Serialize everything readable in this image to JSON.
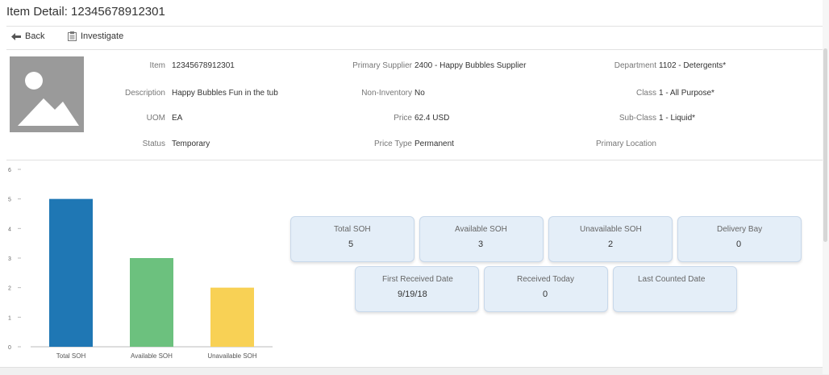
{
  "page": {
    "title": "Item Detail: 12345678912301"
  },
  "toolbar": {
    "back_label": "Back",
    "investigate_label": "Investigate"
  },
  "details": {
    "item_label": "Item",
    "item_value": "12345678912301",
    "description_label": "Description",
    "description_value": "Happy Bubbles Fun in the tub",
    "uom_label": "UOM",
    "uom_value": "EA",
    "status_label": "Status",
    "status_value": "Temporary",
    "primary_supplier_label": "Primary Supplier",
    "primary_supplier_value": "2400 - Happy Bubbles Supplier",
    "non_inventory_label": "Non-Inventory",
    "non_inventory_value": "No",
    "price_label": "Price",
    "price_value": "62.4 USD",
    "price_type_label": "Price Type",
    "price_type_value": "Permanent",
    "department_label": "Department",
    "department_value": "1102 - Detergents*",
    "class_label": "Class",
    "class_value": "1 - All Purpose*",
    "subclass_label": "Sub-Class",
    "subclass_value": "1 - Liquid*",
    "primary_location_label": "Primary Location",
    "primary_location_value": ""
  },
  "tiles": {
    "total_soh_label": "Total SOH",
    "total_soh_value": "5",
    "available_soh_label": "Available SOH",
    "available_soh_value": "3",
    "unavailable_soh_label": "Unavailable SOH",
    "unavailable_soh_value": "2",
    "delivery_bay_label": "Delivery Bay",
    "delivery_bay_value": "0",
    "first_received_label": "First Received Date",
    "first_received_value": "9/19/18",
    "received_today_label": "Received Today",
    "received_today_value": "0",
    "last_counted_label": "Last Counted Date",
    "last_counted_value": ""
  },
  "chart_data": {
    "type": "bar",
    "categories": [
      "Total SOH",
      "Available SOH",
      "Unavailable SOH"
    ],
    "values": [
      5,
      3,
      2
    ],
    "colors": [
      "#1f77b4",
      "#6cc17e",
      "#f8d155"
    ],
    "ylim": [
      0,
      6
    ],
    "yticks": [
      "0",
      "1",
      "2",
      "3",
      "4",
      "5",
      "6"
    ],
    "grid": false
  }
}
